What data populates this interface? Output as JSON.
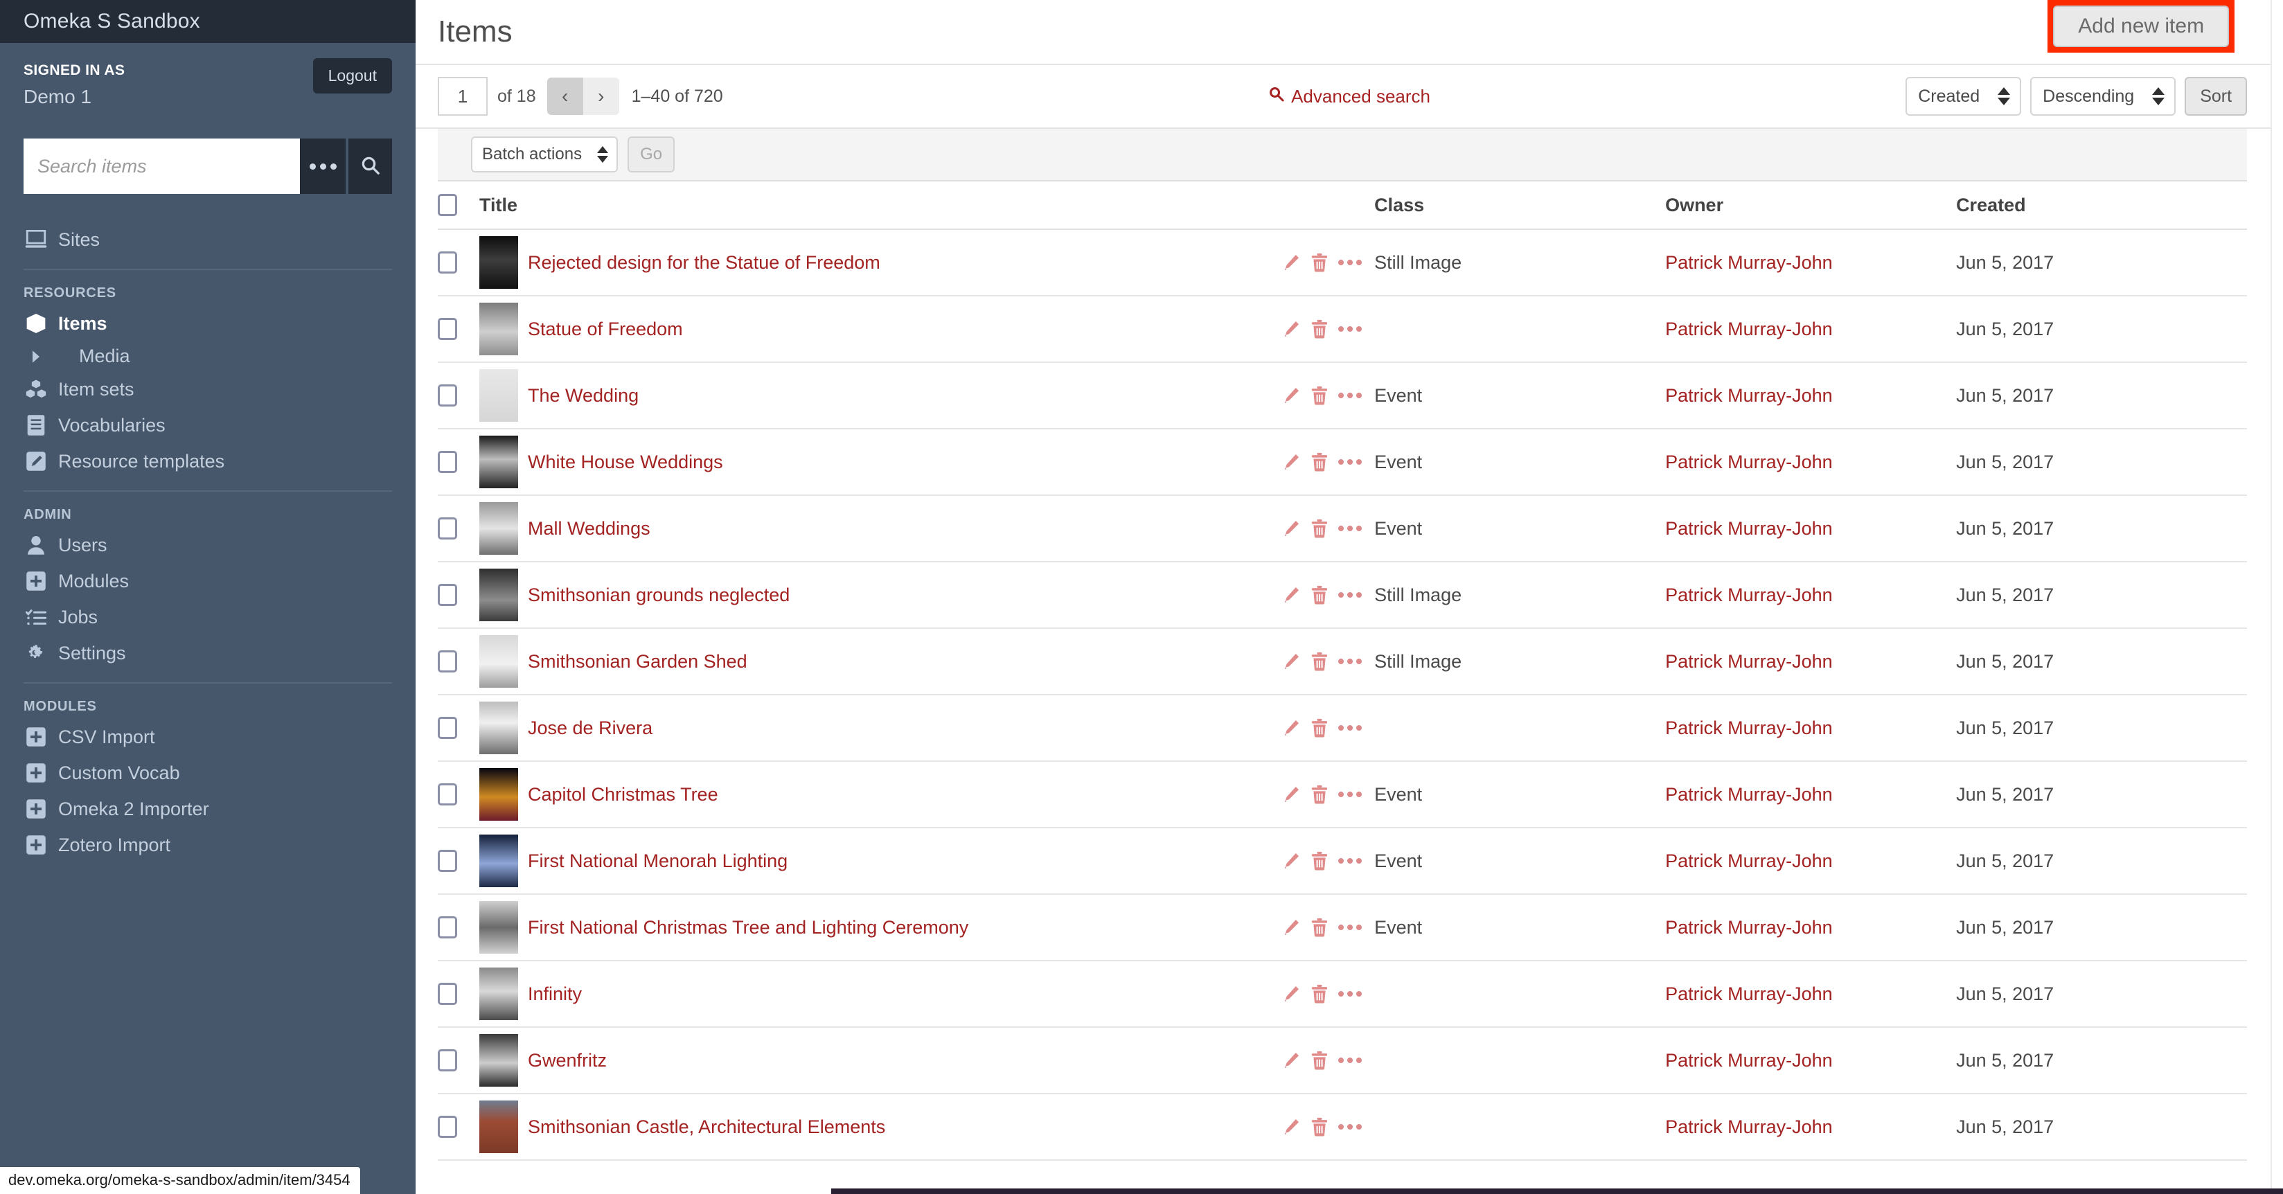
{
  "sidebar": {
    "site_title": "Omeka S Sandbox",
    "signed_in_label": "SIGNED IN AS",
    "user_name": "Demo 1",
    "logout_label": "Logout",
    "search_placeholder": "Search items",
    "search_value": "",
    "advanced_options_icon": "ellipsis-icon",
    "search_icon": "search-icon",
    "top_items": [
      {
        "label": "Sites",
        "icon": "monitor-icon"
      }
    ],
    "sections": [
      {
        "label": "RESOURCES",
        "items": [
          {
            "label": "Items",
            "icon": "cube-icon",
            "active": true
          },
          {
            "label": "Media",
            "icon": "caret-right-icon",
            "sub": true
          },
          {
            "label": "Item sets",
            "icon": "cubes-icon"
          },
          {
            "label": "Vocabularies",
            "icon": "book-icon"
          },
          {
            "label": "Resource templates",
            "icon": "pencil-square-icon"
          }
        ]
      },
      {
        "label": "ADMIN",
        "items": [
          {
            "label": "Users",
            "icon": "user-icon"
          },
          {
            "label": "Modules",
            "icon": "plus-square-icon"
          },
          {
            "label": "Jobs",
            "icon": "tasks-icon"
          },
          {
            "label": "Settings",
            "icon": "gears-icon"
          }
        ]
      },
      {
        "label": "MODULES",
        "items": [
          {
            "label": "CSV Import",
            "icon": "plus-square-icon"
          },
          {
            "label": "Custom Vocab",
            "icon": "plus-square-icon"
          },
          {
            "label": "Omeka 2 Importer",
            "icon": "plus-square-icon"
          },
          {
            "label": "Zotero Import",
            "icon": "plus-square-icon"
          }
        ]
      }
    ]
  },
  "status_bar": {
    "url": "dev.omeka.org/omeka-s-sandbox/admin/item/3454"
  },
  "header": {
    "page_title": "Items",
    "add_new_label": "Add new item",
    "highlight_color": "#fc2b00"
  },
  "toolbar": {
    "page_number": "1",
    "of_label": "of 18",
    "prev_label": "‹",
    "next_label": "›",
    "range_label": "1–40 of 720",
    "advanced_search_label": "Advanced search",
    "advanced_search_icon": "search-icon",
    "sort_by_value": "Created",
    "sort_dir_value": "Descending",
    "sort_button_label": "Sort"
  },
  "batch": {
    "actions_value": "Batch actions",
    "go_label": "Go"
  },
  "table": {
    "columns": [
      "Title",
      "Class",
      "Owner",
      "Created"
    ],
    "rows": [
      {
        "title": "Rejected design for the Statue of Freedom",
        "class": "Still Image",
        "owner": "Patrick Murray-John",
        "created": "Jun 5, 2017",
        "thumb": "statue-dark"
      },
      {
        "title": "Statue of Freedom",
        "class": "",
        "owner": "Patrick Murray-John",
        "created": "Jun 5, 2017",
        "thumb": "statue-capitol"
      },
      {
        "title": "The Wedding",
        "class": "Event",
        "owner": "Patrick Murray-John",
        "created": "Jun 5, 2017",
        "thumb": "newspaper"
      },
      {
        "title": "White House Weddings",
        "class": "Event",
        "owner": "Patrick Murray-John",
        "created": "Jun 5, 2017",
        "thumb": "cake"
      },
      {
        "title": "Mall Weddings",
        "class": "Event",
        "owner": "Patrick Murray-John",
        "created": "Jun 5, 2017",
        "thumb": "rotunda"
      },
      {
        "title": "Smithsonian grounds neglected",
        "class": "Still Image",
        "owner": "Patrick Murray-John",
        "created": "Jun 5, 2017",
        "thumb": "castle-bw"
      },
      {
        "title": "Smithsonian Garden Shed",
        "class": "Still Image",
        "owner": "Patrick Murray-John",
        "created": "Jun 5, 2017",
        "thumb": "shed"
      },
      {
        "title": "Jose de Rivera",
        "class": "",
        "owner": "Patrick Murray-John",
        "created": "Jun 5, 2017",
        "thumb": "portrait"
      },
      {
        "title": "Capitol Christmas Tree",
        "class": "Event",
        "owner": "Patrick Murray-John",
        "created": "Jun 5, 2017",
        "thumb": "tree-night"
      },
      {
        "title": "First National Menorah Lighting",
        "class": "Event",
        "owner": "Patrick Murray-John",
        "created": "Jun 5, 2017",
        "thumb": "menorah"
      },
      {
        "title": "First National Christmas Tree and Lighting Ceremony",
        "class": "Event",
        "owner": "Patrick Murray-John",
        "created": "Jun 5, 2017",
        "thumb": "tree-bw"
      },
      {
        "title": "Infinity",
        "class": "",
        "owner": "Patrick Murray-John",
        "created": "Jun 5, 2017",
        "thumb": "sculpture"
      },
      {
        "title": "Gwenfritz",
        "class": "",
        "owner": "Patrick Murray-John",
        "created": "Jun 5, 2017",
        "thumb": "gwen"
      },
      {
        "title": "Smithsonian Castle, Architectural Elements",
        "class": "",
        "owner": "Patrick Murray-John",
        "created": "Jun 5, 2017",
        "thumb": "castle-color"
      }
    ],
    "row_action_icons": [
      "pencil-icon",
      "trash-icon",
      "ellipsis-icon"
    ]
  },
  "colors": {
    "sidebar_bg": "#46566b",
    "sidebar_dark": "#242c38",
    "link_red": "#a32222",
    "highlight_red": "#fc2b00"
  }
}
